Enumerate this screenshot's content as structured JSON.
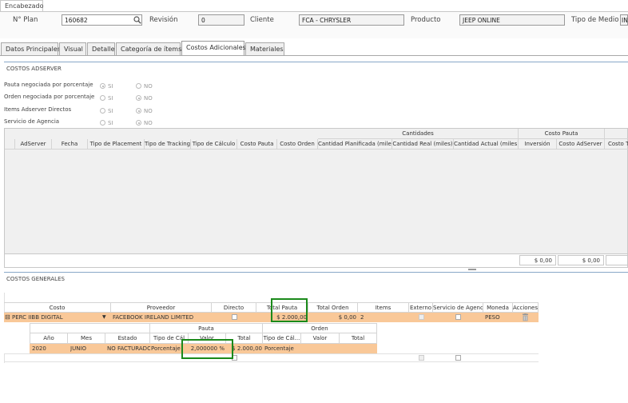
{
  "header": {
    "tab_label": "Encabezado",
    "plan_label": "N° Plan",
    "plan_value": "160682",
    "revision_label": "Revisión",
    "revision_value": "0",
    "cliente_label": "Cliente",
    "cliente_value": "FCA - CHRYSLER",
    "producto_label": "Producto",
    "producto_value": "JEEP ONLINE",
    "tipo_medio_label": "Tipo de Medio",
    "tipo_medio_value": "IN"
  },
  "tabs": [
    {
      "label": "Datos Principales"
    },
    {
      "label": "Visual"
    },
    {
      "label": "Detalle"
    },
    {
      "label": "Categoría de ítems"
    },
    {
      "label": "Costos Adicionales"
    },
    {
      "label": "Materiales"
    }
  ],
  "adserver": {
    "title": "COSTOS ADSERVER",
    "options": [
      {
        "label": "Pauta negociada por porcentaje",
        "si": "SI",
        "no": "NO",
        "selected": "si"
      },
      {
        "label": "Orden negociada por porcentaje",
        "si": "SI",
        "no": "NO",
        "selected": "no"
      },
      {
        "label": "Items Adserver Directos",
        "si": "SI",
        "no": "NO",
        "selected": "no"
      },
      {
        "label": "Servicio de Agencia",
        "si": "SI",
        "no": "NO",
        "selected": "no"
      }
    ],
    "group_headers": {
      "cantidades": "Cantidades",
      "costo_pauta": "Costo Pauta"
    },
    "columns": [
      "AdServer",
      "Fecha",
      "Tipo de Placement",
      "Tipo de Tracking",
      "Tipo de Cálculo",
      "Costo Pauta",
      "Costo Orden",
      "Cantidad Planificada (miles)",
      "Cantidad Real (miles)",
      "Cantidad Actual (miles)",
      "Inversión",
      "Costo AdServer",
      "Costo To"
    ],
    "totals": [
      "$ 0,00",
      "$ 0,00"
    ]
  },
  "generales": {
    "title": "COSTOS GENERALES",
    "columns": [
      "Costo",
      "Proveedor",
      "Directo",
      "Total Pauta",
      "Total Orden",
      "Items",
      "Externo",
      "Servicio de Agencia",
      "Moneda",
      "Acciones"
    ],
    "row": {
      "expand": "⊟",
      "costo": "PERC IIBB DIGITAL",
      "proveedor": "FACEBOOK IRELAND LIMITED",
      "total_pauta": "$ 2.000,00",
      "total_orden": "$ 0,00",
      "items": "2",
      "moneda": "PESO"
    },
    "sub": {
      "pauta_header": "Pauta",
      "orden_header": "Orden",
      "columns": [
        "Año",
        "Mes",
        "Estado",
        "Tipo de Cál",
        "Valor",
        "Total",
        "Tipo de Cál...",
        "Valor",
        "Total"
      ],
      "row": {
        "anio": "2020",
        "mes": "JUNIO",
        "estado": "NO FACTURADO",
        "tipo_calc_pauta": "Porcentaje",
        "valor_pauta": "2,000000 %",
        "total_pauta": "$ 2.000,00",
        "tipo_calc_orden": "Porcentaje"
      }
    }
  },
  "colors": {
    "row_highlight": "#f9c898",
    "highlight_box": "#1b8a1b",
    "section_line": "#89a8c8"
  }
}
